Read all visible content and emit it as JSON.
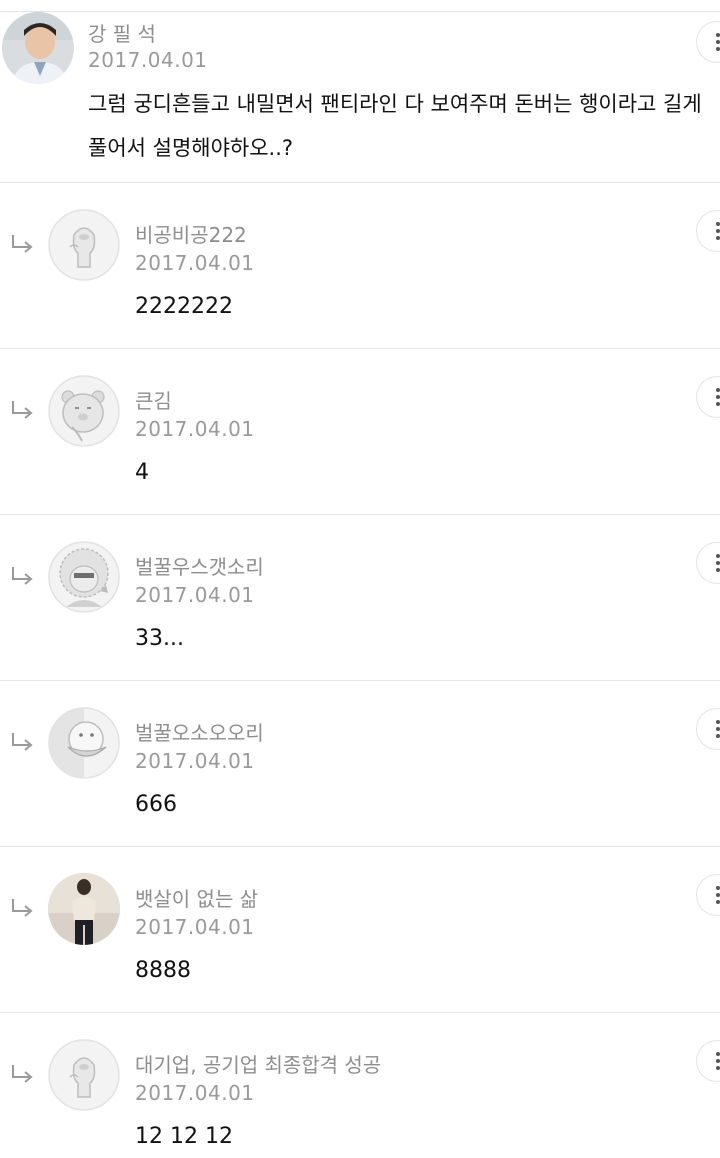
{
  "comments": [
    {
      "name": "강 필 석",
      "date": "2017.04.01",
      "text": "그럼 궁디흔들고 내밀면서 팬티라인 다 보여주며 돈버는 행이라고 길게 풀어서 설명해야하오..?",
      "avatar_icon": "photo-avatar"
    }
  ],
  "replies": [
    {
      "name": "비공비공222",
      "date": "2017.04.01",
      "text": "2222222",
      "avatar_icon": "default-character-avatar"
    },
    {
      "name": "큰김",
      "date": "2017.04.01",
      "text": "4",
      "avatar_icon": "lion-character-avatar"
    },
    {
      "name": "벌꿀우스갯소리",
      "date": "2017.04.01",
      "text": "33...",
      "avatar_icon": "curly-character-avatar"
    },
    {
      "name": "벌꿀오소오오리",
      "date": "2017.04.01",
      "text": "666",
      "avatar_icon": "duck-character-avatar"
    },
    {
      "name": "뱃살이 없는 삶",
      "date": "2017.04.01",
      "text": "8888",
      "avatar_icon": "photo-avatar"
    },
    {
      "name": "대기업, 공기업 최종합격 성공",
      "date": "2017.04.01",
      "text": "12 12 12",
      "avatar_icon": "default-character-avatar"
    }
  ],
  "colors": {
    "name": "#8e8e8e",
    "date": "#9a9a9a",
    "text": "#111111",
    "divider": "#e6e6e6"
  }
}
